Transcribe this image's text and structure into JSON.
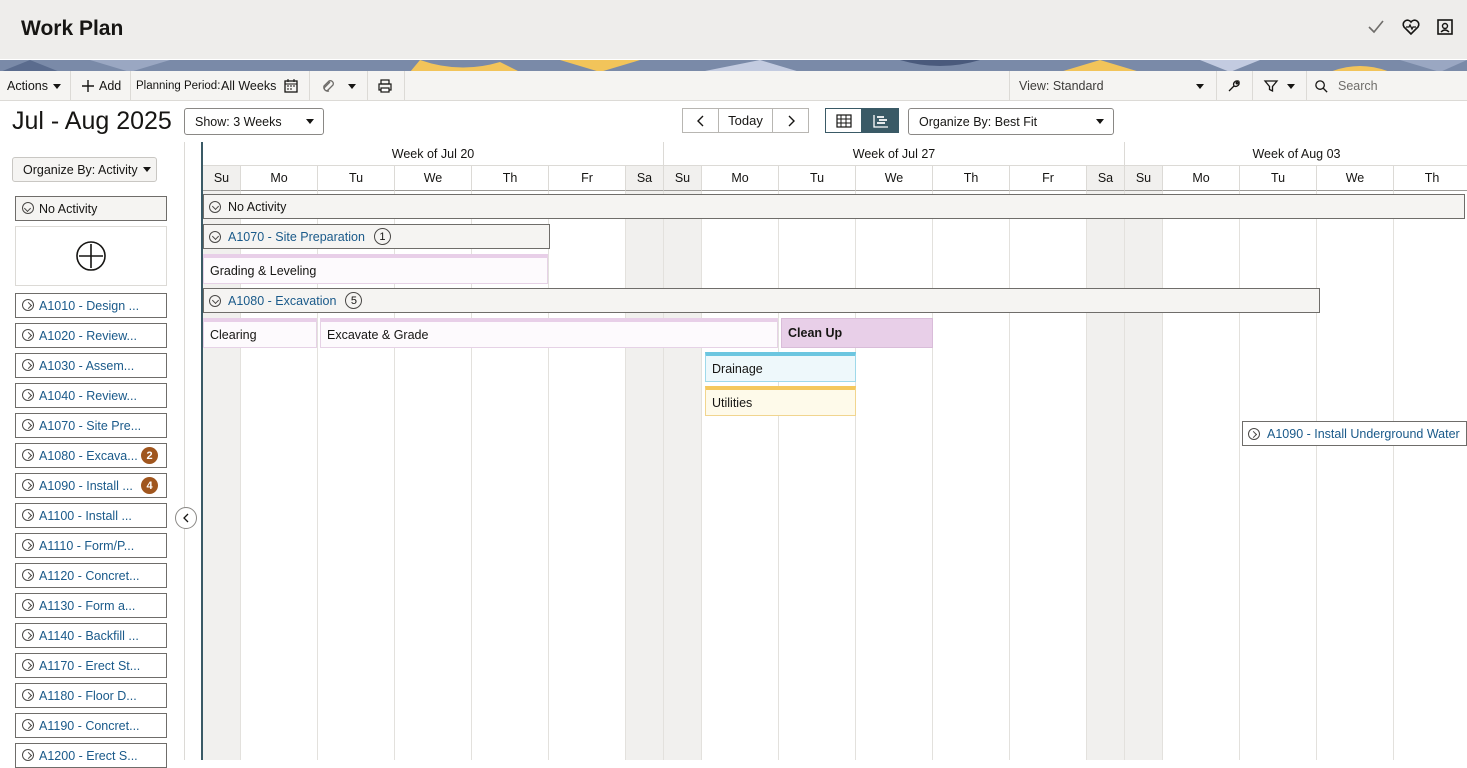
{
  "header": {
    "title": "Work Plan"
  },
  "toolbar": {
    "actions": "Actions",
    "add": "Add",
    "planning_period_label": "Planning Period:",
    "planning_period_value": "All Weeks",
    "view": "View: Standard",
    "search_placeholder": "Search"
  },
  "controls": {
    "range_title": "Jul - Aug 2025",
    "show": "Show: 3 Weeks",
    "today": "Today",
    "organize_grid": "Organize By: Best Fit"
  },
  "sidebar": {
    "organize": "Organize By: Activity",
    "no_activity": "No Activity",
    "items": [
      {
        "label": "A1010 - Design ...",
        "badge": ""
      },
      {
        "label": "A1020 - Review...",
        "badge": ""
      },
      {
        "label": "A1030 - Assem...",
        "badge": ""
      },
      {
        "label": "A1040 - Review...",
        "badge": ""
      },
      {
        "label": "A1070 - Site Pre...",
        "badge": ""
      },
      {
        "label": "A1080 - Excava...",
        "badge": "2"
      },
      {
        "label": "A1090 - Install ...",
        "badge": "4"
      },
      {
        "label": "A1100 - Install ...",
        "badge": ""
      },
      {
        "label": "A1110 - Form/P...",
        "badge": ""
      },
      {
        "label": "A1120 - Concret...",
        "badge": ""
      },
      {
        "label": "A1130 - Form a...",
        "badge": ""
      },
      {
        "label": "A1140 - Backfill ...",
        "badge": ""
      },
      {
        "label": "A1170 - Erect St...",
        "badge": ""
      },
      {
        "label": "A1180 - Floor D...",
        "badge": ""
      },
      {
        "label": "A1190 - Concret...",
        "badge": ""
      },
      {
        "label": "A1200 - Erect S...",
        "badge": ""
      }
    ]
  },
  "calendar": {
    "weeks": [
      "Week of Jul 20",
      "Week of Jul 27",
      "Week of Aug 03"
    ],
    "days": [
      "Su",
      "Mo",
      "Tu",
      "We",
      "Th",
      "Fr",
      "Sa",
      "Su",
      "Mo",
      "Tu",
      "We",
      "Th",
      "Fr",
      "Sa",
      "Su",
      "Mo",
      "Tu",
      "We",
      "Th"
    ],
    "groups": {
      "no_activity": "No Activity",
      "a1070": {
        "label": "A1070 - Site Preparation",
        "count": "1"
      },
      "a1080": {
        "label": "A1080 - Excavation",
        "count": "5"
      },
      "a1090": {
        "label": "A1090 - Install Underground Water"
      }
    },
    "tasks": {
      "grading": "Grading & Leveling",
      "clearing": "Clearing",
      "excavate": "Excavate & Grade",
      "cleanup": "Clean Up",
      "drainage": "Drainage",
      "utilities": "Utilities"
    }
  },
  "colors": {
    "accent": "#3a5a66",
    "link": "#1a5a8a",
    "badge": "#a0561e",
    "pink": "#e8cfe8",
    "blue": "#6cc6e0",
    "yellow": "#f5c85e"
  }
}
